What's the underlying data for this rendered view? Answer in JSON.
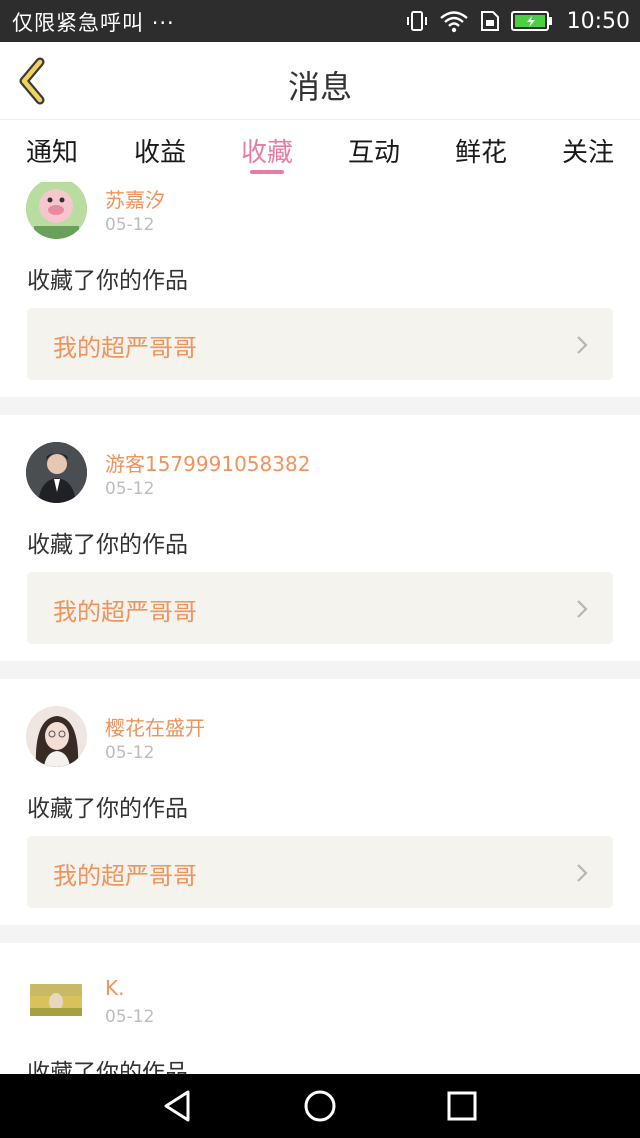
{
  "status_bar": {
    "carrier": "仅限紧急呼叫",
    "more": "···",
    "time": "10:50"
  },
  "header": {
    "title": "消息"
  },
  "tabs": [
    {
      "label": "通知",
      "active": false
    },
    {
      "label": "收益",
      "active": false
    },
    {
      "label": "收藏",
      "active": true
    },
    {
      "label": "互动",
      "active": false
    },
    {
      "label": "鲜花",
      "active": false
    },
    {
      "label": "关注",
      "active": false
    }
  ],
  "colors": {
    "accent_pink": "#e87ca8",
    "accent_orange": "#f0935c",
    "card_link_bg": "#f4f3ee"
  },
  "messages": [
    {
      "username": "苏嘉汐",
      "date": "05-12",
      "action": "收藏了你的作品",
      "work_title": "我的超严哥哥"
    },
    {
      "username": "游客1579991058382",
      "date": "05-12",
      "action": "收藏了你的作品",
      "work_title": "我的超严哥哥"
    },
    {
      "username": "樱花在盛开",
      "date": "05-12",
      "action": "收藏了你的作品",
      "work_title": "我的超严哥哥"
    },
    {
      "username": "K.",
      "date": "05-12",
      "action": "收藏了你的作品",
      "work_title": ""
    }
  ]
}
